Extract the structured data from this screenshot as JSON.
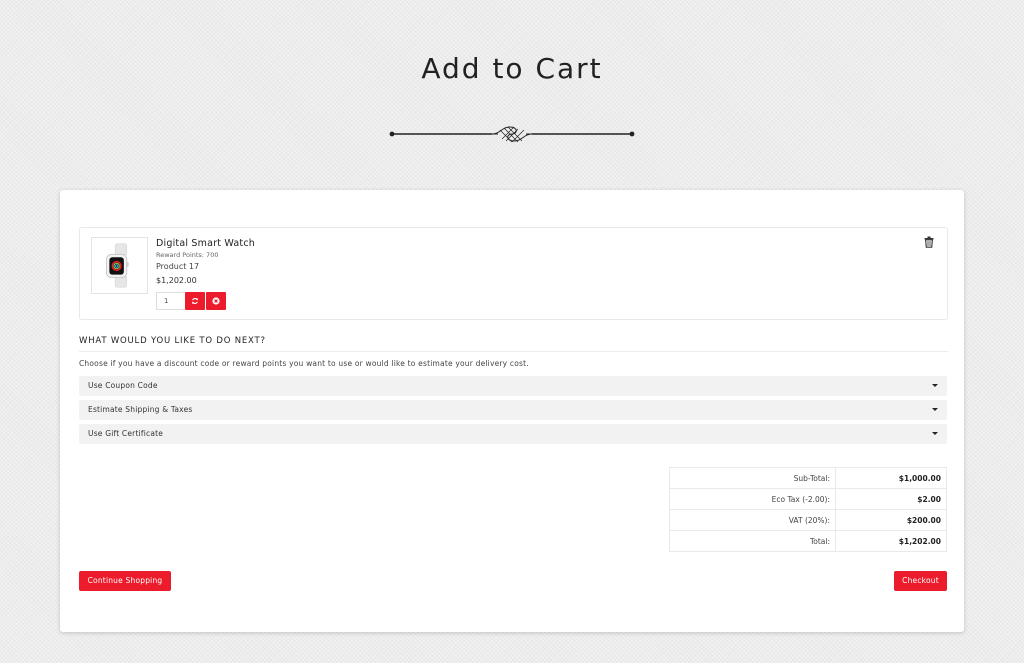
{
  "page": {
    "title": "Add to Cart"
  },
  "cart": {
    "item": {
      "name": "Digital Smart Watch",
      "reward_points": "Reward Points: 700",
      "model": "Product 17",
      "price": "$1,202.00",
      "quantity": "1"
    },
    "next_section": {
      "title": "WHAT WOULD YOU LIKE TO DO NEXT?",
      "description": "Choose if you have a discount code or reward points you want to use or would like to estimate your delivery cost.",
      "options": [
        {
          "label": "Use Coupon Code"
        },
        {
          "label": "Estimate Shipping & Taxes"
        },
        {
          "label": "Use Gift Certificate"
        }
      ]
    },
    "totals": [
      {
        "label": "Sub-Total:",
        "value": "$1,000.00"
      },
      {
        "label": "Eco Tax (-2.00):",
        "value": "$2.00"
      },
      {
        "label": "VAT (20%):",
        "value": "$200.00"
      },
      {
        "label": "Total:",
        "value": "$1,202.00"
      }
    ],
    "buttons": {
      "continue": "Continue Shopping",
      "checkout": "Checkout"
    }
  },
  "colors": {
    "accent": "#ec1c2c",
    "background": "#ececec"
  },
  "icons": {
    "refresh": "refresh-icon",
    "remove": "remove-circle-icon",
    "trash": "trash-icon",
    "caret": "caret-down-icon"
  }
}
